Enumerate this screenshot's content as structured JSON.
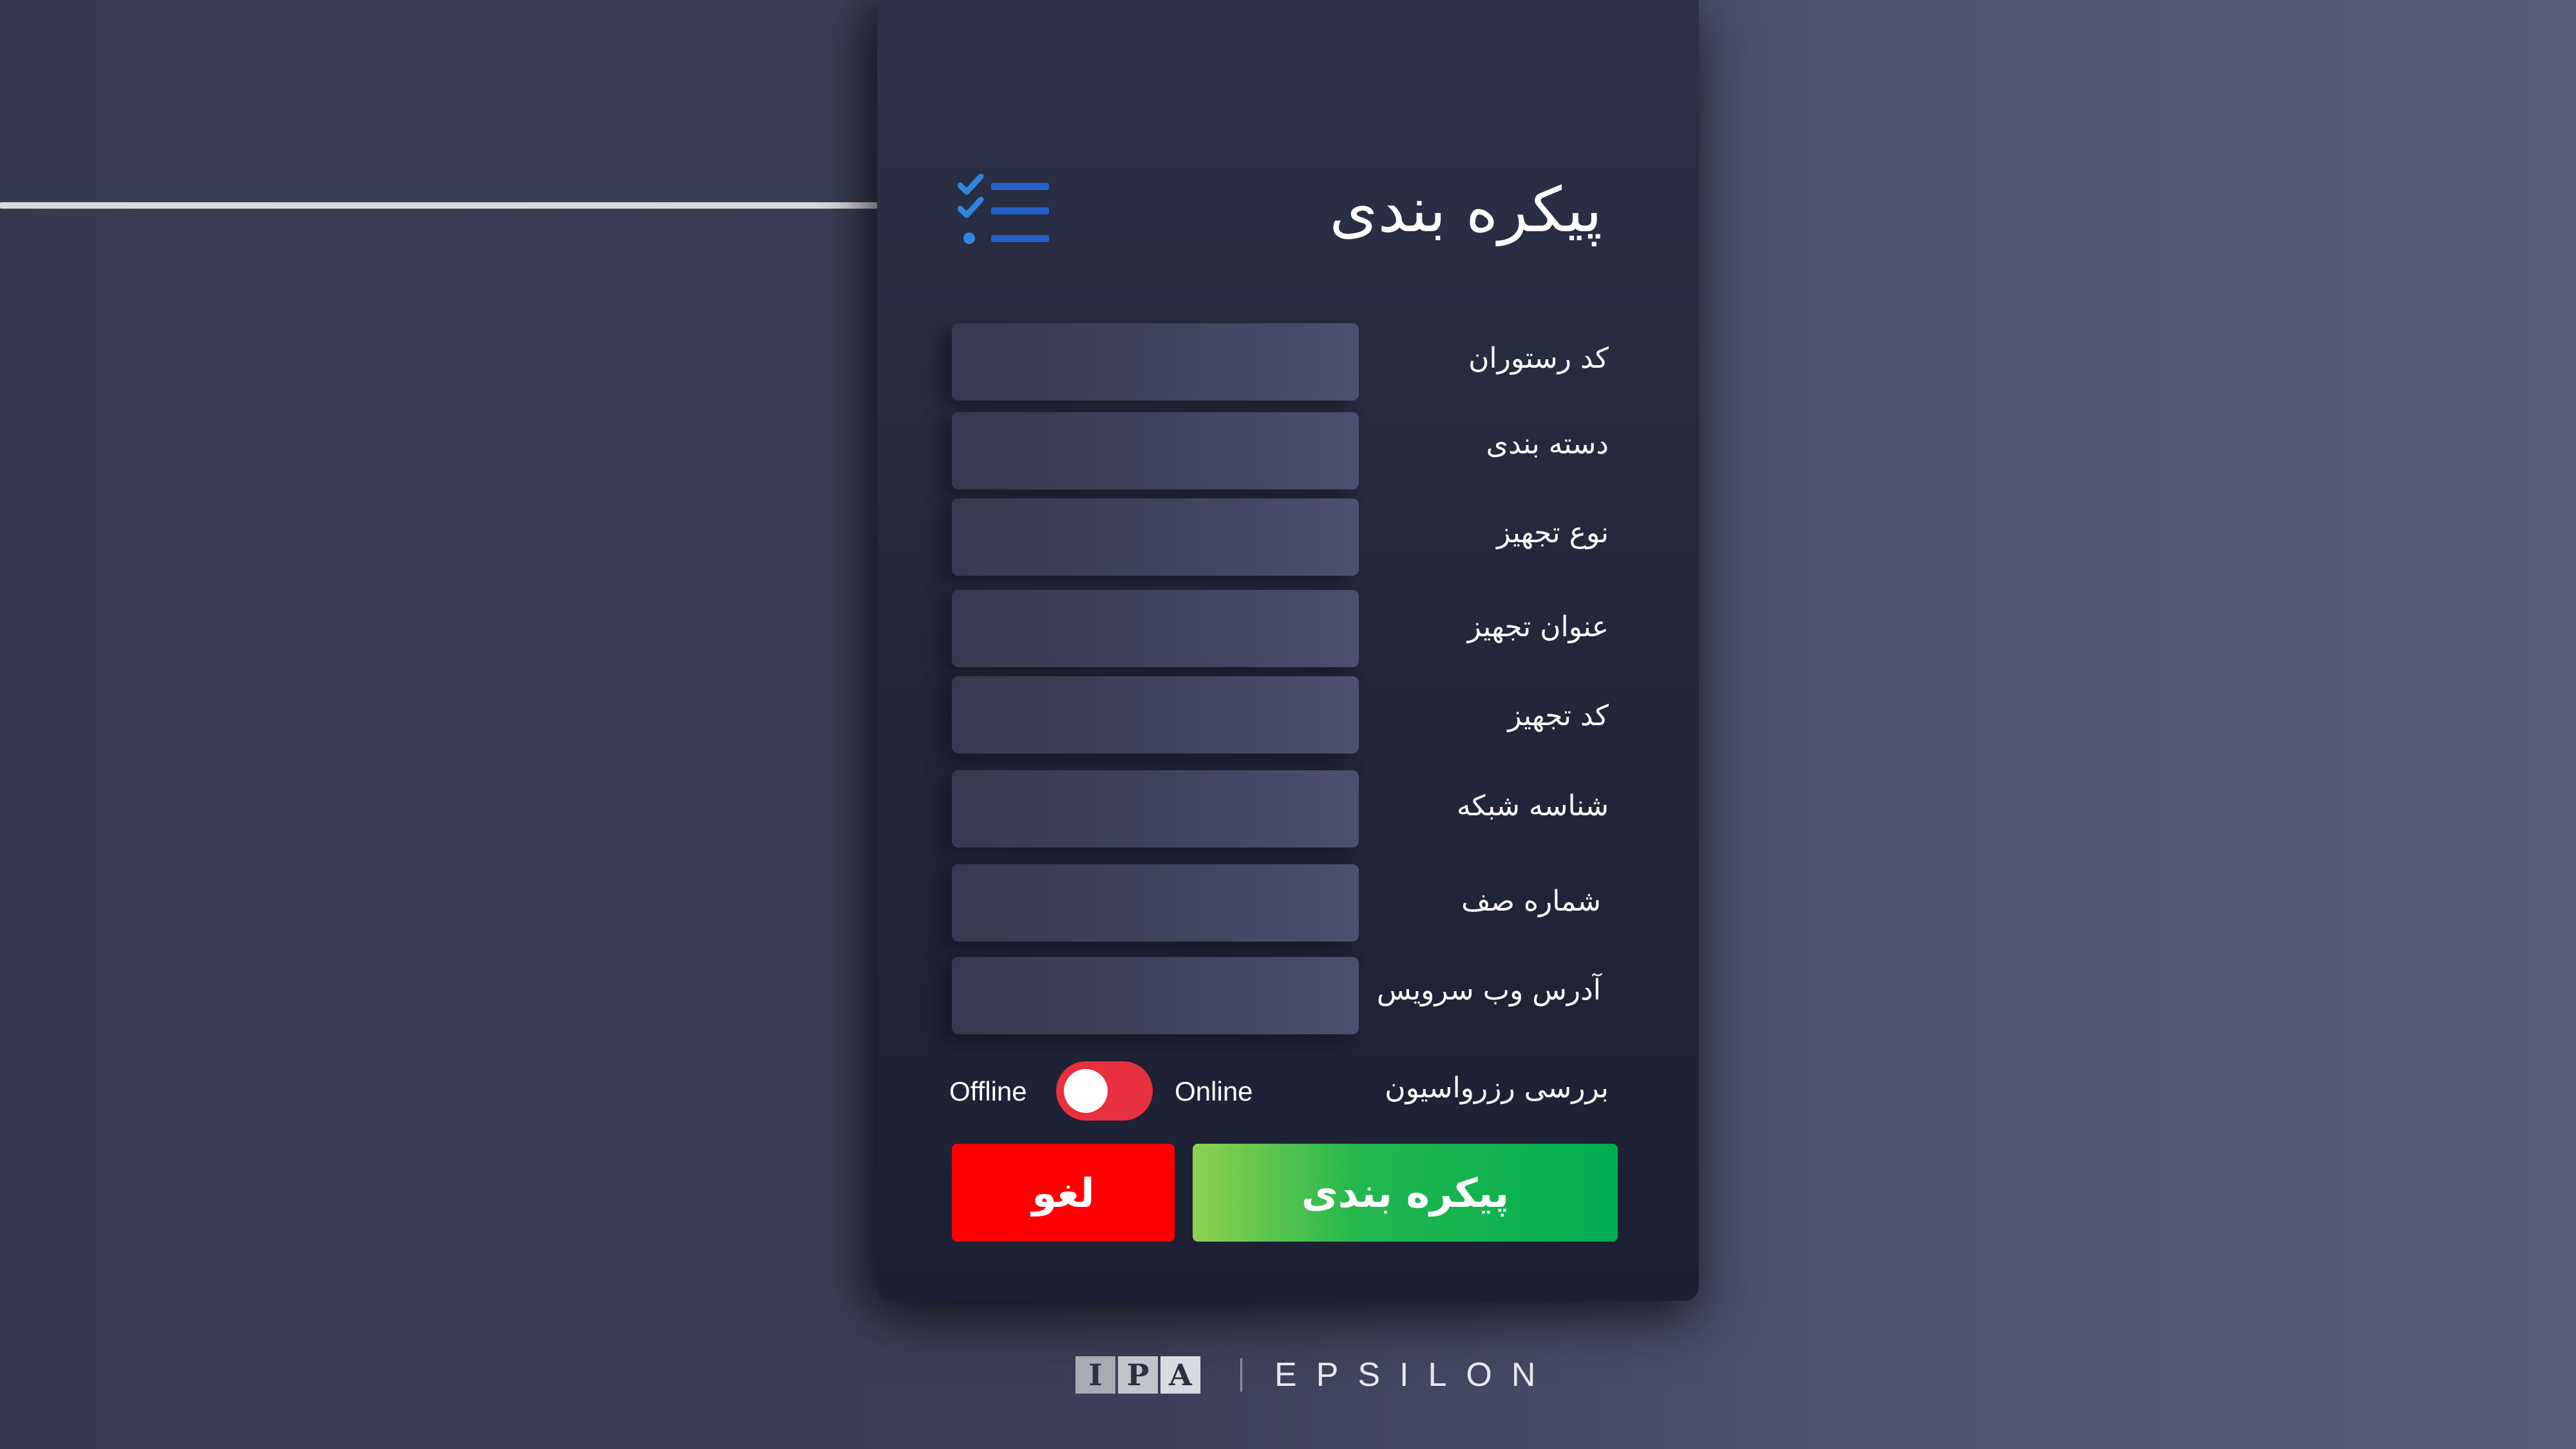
{
  "window": {
    "title": "پیکره بندی"
  },
  "form": {
    "fields": [
      {
        "label": "کد رستوران",
        "value": ""
      },
      {
        "label": "دسته بندی",
        "value": ""
      },
      {
        "label": "نوع تجهیز",
        "value": ""
      },
      {
        "label": "عنوان تجهیز",
        "value": ""
      },
      {
        "label": "کد تجهیز",
        "value": ""
      },
      {
        "label": "شناسه شبکه",
        "value": ""
      },
      {
        "label": "شماره صف",
        "value": ""
      },
      {
        "label": "آدرس وب سرویس",
        "value": ""
      }
    ],
    "reservation_check": {
      "label": "بررسی رزرواسیون",
      "on_label": "Online",
      "off_label": "Offline",
      "state": "offline",
      "color": "#e8303e"
    }
  },
  "actions": {
    "submit_label": "پیکره بندی",
    "cancel_label": "لغو",
    "submit_color": "#00ad50",
    "cancel_color": "#ff0000"
  },
  "icons": {
    "title_icon": "checklist-icon"
  },
  "footer": {
    "logo_letters": [
      "I",
      "P",
      "A"
    ],
    "brand": "EPSILON"
  }
}
